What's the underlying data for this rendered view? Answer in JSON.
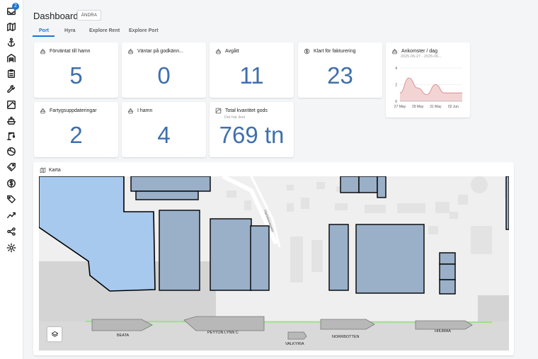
{
  "sidebar": {
    "notification_count": "2",
    "items": [
      "inbox-icon",
      "map-icon",
      "anchor-icon",
      "garage-icon",
      "clipboard-icon",
      "wrench-icon",
      "image-icon",
      "ship-icon",
      "crane-icon",
      "globe-icon",
      "tag-icon",
      "dollar-icon",
      "label-icon",
      "trending-icon",
      "share-icon",
      "settings-icon"
    ]
  },
  "header": {
    "title": "Dashboard",
    "edit_label": "ÄNDRA"
  },
  "tabs": [
    {
      "label": "Port",
      "active": true
    },
    {
      "label": "Hyra",
      "active": false
    },
    {
      "label": "Explore Rent",
      "active": false
    },
    {
      "label": "Explore Port",
      "active": false
    }
  ],
  "cards": {
    "expected": {
      "label": "Förväntat till hamn",
      "value": "5"
    },
    "waiting": {
      "label": "Väntar på godkänn...",
      "value": "0"
    },
    "departed": {
      "label": "Avgått",
      "value": "11"
    },
    "invoice": {
      "label": "Klart för fakturering",
      "value": "23"
    },
    "updates": {
      "label": "Fartygsuppdateringar",
      "value": "2"
    },
    "in_port": {
      "label": "I hamn",
      "value": "4"
    },
    "cargo": {
      "label": "Total kvantitet gods",
      "sub": "Det här året",
      "value": "769 tn"
    }
  },
  "arrivals": {
    "label": "Ankomster / dag",
    "range": "2025-05-27 - 2025-06..."
  },
  "chart_data": {
    "type": "area",
    "title": "Ankomster / dag",
    "subtitle": "2025-05-27 - 2025-06...",
    "x_ticks": [
      "27 May",
      "29 May",
      "31 May",
      "02 Jun"
    ],
    "x": [
      "2025-05-27",
      "2025-05-28",
      "2025-05-29",
      "2025-05-30",
      "2025-05-31",
      "2025-06-01",
      "2025-06-02",
      "2025-06-03"
    ],
    "values": [
      1,
      2.8,
      1.6,
      0.8,
      2.0,
      1.0,
      1.0,
      1.0
    ],
    "ylim": [
      0,
      4
    ],
    "y_ticks": [
      "0",
      "2",
      "4"
    ],
    "grid": true,
    "color": "#e8a8aa"
  },
  "map": {
    "label": "Karta",
    "street": "Hamnbanegatan",
    "ships": [
      "BEATA",
      "PEYTON LYNN C",
      "VALKYRIA",
      "NORRBOTTEN",
      "HIIUMAA"
    ],
    "water_color": "#a8c9ee",
    "building_color": "#9ab0c9"
  },
  "colors": {
    "accent": "#1976d2",
    "value": "#3f6fad"
  }
}
